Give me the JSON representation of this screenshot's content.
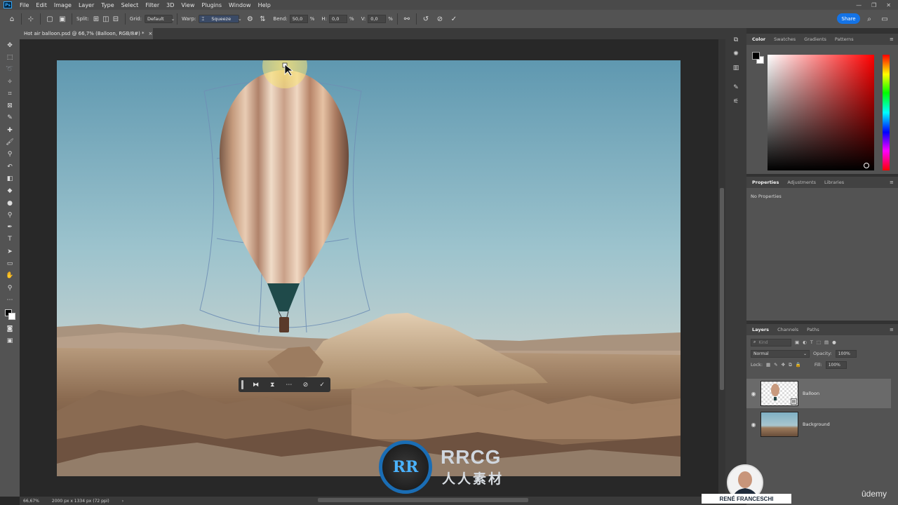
{
  "menubar": {
    "app_icon": "Ps",
    "items": [
      "File",
      "Edit",
      "Image",
      "Layer",
      "Type",
      "Select",
      "Filter",
      "3D",
      "View",
      "Plugins",
      "Window",
      "Help"
    ],
    "window_controls": [
      "—",
      "❐",
      "✕"
    ]
  },
  "optionsbar": {
    "split_label": "Split:",
    "grid_label": "Grid:",
    "grid_value": "Default",
    "warp_label": "Warp:",
    "warp_value": "Squeeze",
    "bend_label": "Bend:",
    "bend_value": "50,0",
    "bend_unit": "%",
    "h_label": "H:",
    "h_value": "0,0",
    "h_unit": "%",
    "v_label": "V:",
    "v_value": "0,0",
    "v_unit": "%",
    "share_label": "Share"
  },
  "document": {
    "tab_title": "Hot air balloon.psd @ 66,7% (Balloon, RGB/8#) *",
    "close_glyph": "×"
  },
  "statusbar": {
    "zoom": "66,67%",
    "doc_size": "2000 px x 1334 px (72 ppi)",
    "arrow": "›"
  },
  "color_panel": {
    "tabs": [
      "Color",
      "Swatches",
      "Gradients",
      "Patterns"
    ],
    "foreground": "#000000",
    "background": "#ffffff"
  },
  "properties_panel": {
    "tabs": [
      "Properties",
      "Adjustments",
      "Libraries"
    ],
    "message": "No Properties"
  },
  "layers_panel": {
    "tabs": [
      "Layers",
      "Channels",
      "Paths"
    ],
    "filter_placeholder": "Kind",
    "blend_mode": "Normal",
    "opacity_label": "Opacity:",
    "opacity_value": "100%",
    "lock_label": "Lock:",
    "fill_label": "Fill:",
    "fill_value": "100%",
    "layers": [
      {
        "name": "Balloon",
        "active": true
      },
      {
        "name": "Background",
        "active": false
      }
    ]
  },
  "watermark": {
    "line1": "RRCG",
    "line2": "人人素材",
    "logo_text": "RR"
  },
  "presenter": {
    "name": "RENÉ FRANCESCHI"
  },
  "brand": {
    "udemy": "ûdemy"
  },
  "colors": {
    "share_button": "#1473e6",
    "accent": "#31a8ff"
  }
}
